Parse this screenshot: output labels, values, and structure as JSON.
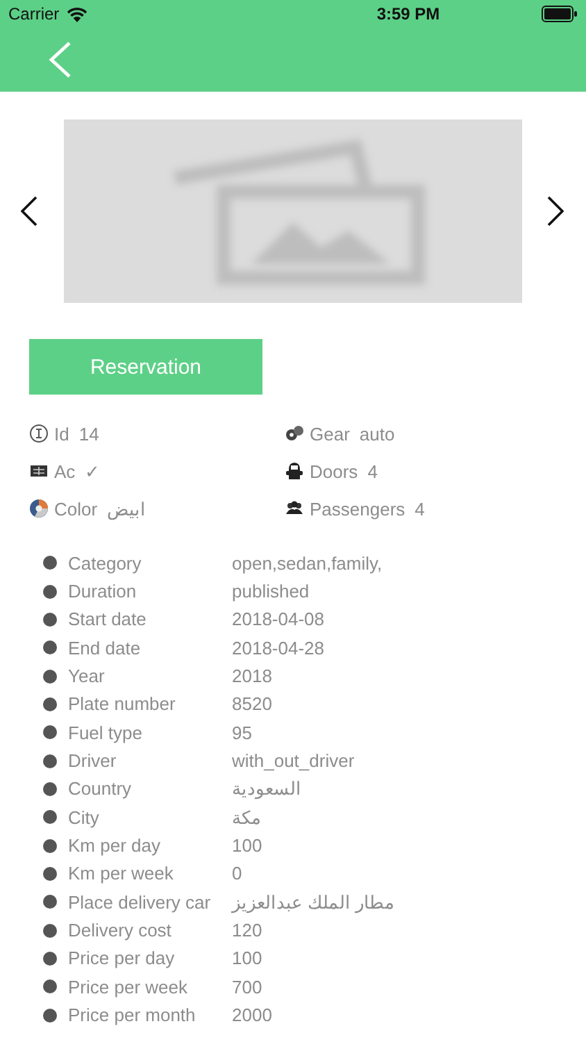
{
  "status_bar": {
    "carrier": "Carrier",
    "time": "3:59 PM"
  },
  "reservation_button": "Reservation",
  "features": [
    {
      "kind": "id",
      "label": "Id",
      "value": "14"
    },
    {
      "kind": "gear",
      "label": "Gear",
      "value": "auto"
    },
    {
      "kind": "ac",
      "label": "Ac",
      "value": "✓"
    },
    {
      "kind": "doors",
      "label": "Doors",
      "value": "4"
    },
    {
      "kind": "color",
      "label": "Color",
      "value": "ابيض"
    },
    {
      "kind": "passengers",
      "label": "Passengers",
      "value": "4"
    }
  ],
  "details": [
    {
      "label": "Category",
      "value": "open,sedan,family,"
    },
    {
      "label": "Duration",
      "value": "published"
    },
    {
      "label": "Start date",
      "value": "2018-04-08"
    },
    {
      "label": "End date",
      "value": "2018-04-28"
    },
    {
      "label": "Year",
      "value": "2018"
    },
    {
      "label": "Plate number",
      "value": "8520"
    },
    {
      "label": "Fuel type",
      "value": "95"
    },
    {
      "label": "Driver",
      "value": "with_out_driver"
    },
    {
      "label": "Country",
      "value": "السعودية"
    },
    {
      "label": "City",
      "value": "مكة"
    },
    {
      "label": "Km per day",
      "value": "100"
    },
    {
      "label": "Km per week",
      "value": "0"
    },
    {
      "label": "Place delivery car",
      "value": "مطار الملك عبدالعزيز"
    },
    {
      "label": "Delivery cost",
      "value": "120"
    },
    {
      "label": "Price per day",
      "value": "100"
    },
    {
      "label": "Price per week",
      "value": "700"
    },
    {
      "label": "Price per month",
      "value": "2000"
    }
  ]
}
